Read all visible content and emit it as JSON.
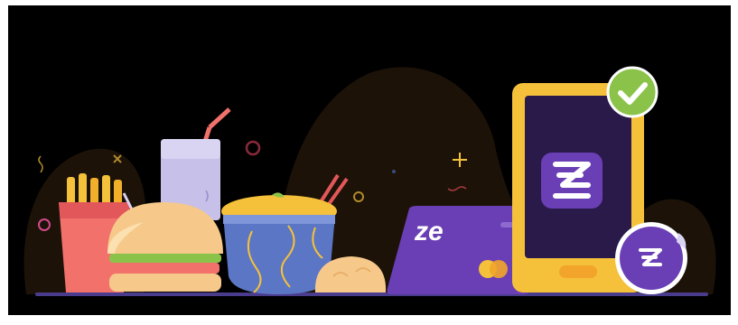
{
  "illustration": {
    "card": {
      "brand_text": "ze"
    },
    "phone": {
      "app_icon": "z-logo-icon",
      "status_icon": "checkmark-icon"
    },
    "coin": {
      "icon": "z-logo-icon"
    },
    "colors": {
      "background": "#000000",
      "blob": "#1c1208",
      "purple": "#6a3fb5",
      "yellow": "#f6c13a",
      "green": "#8bc34a",
      "fries_red": "#f2716b",
      "noodle_bowl": "#5b76c4"
    }
  }
}
